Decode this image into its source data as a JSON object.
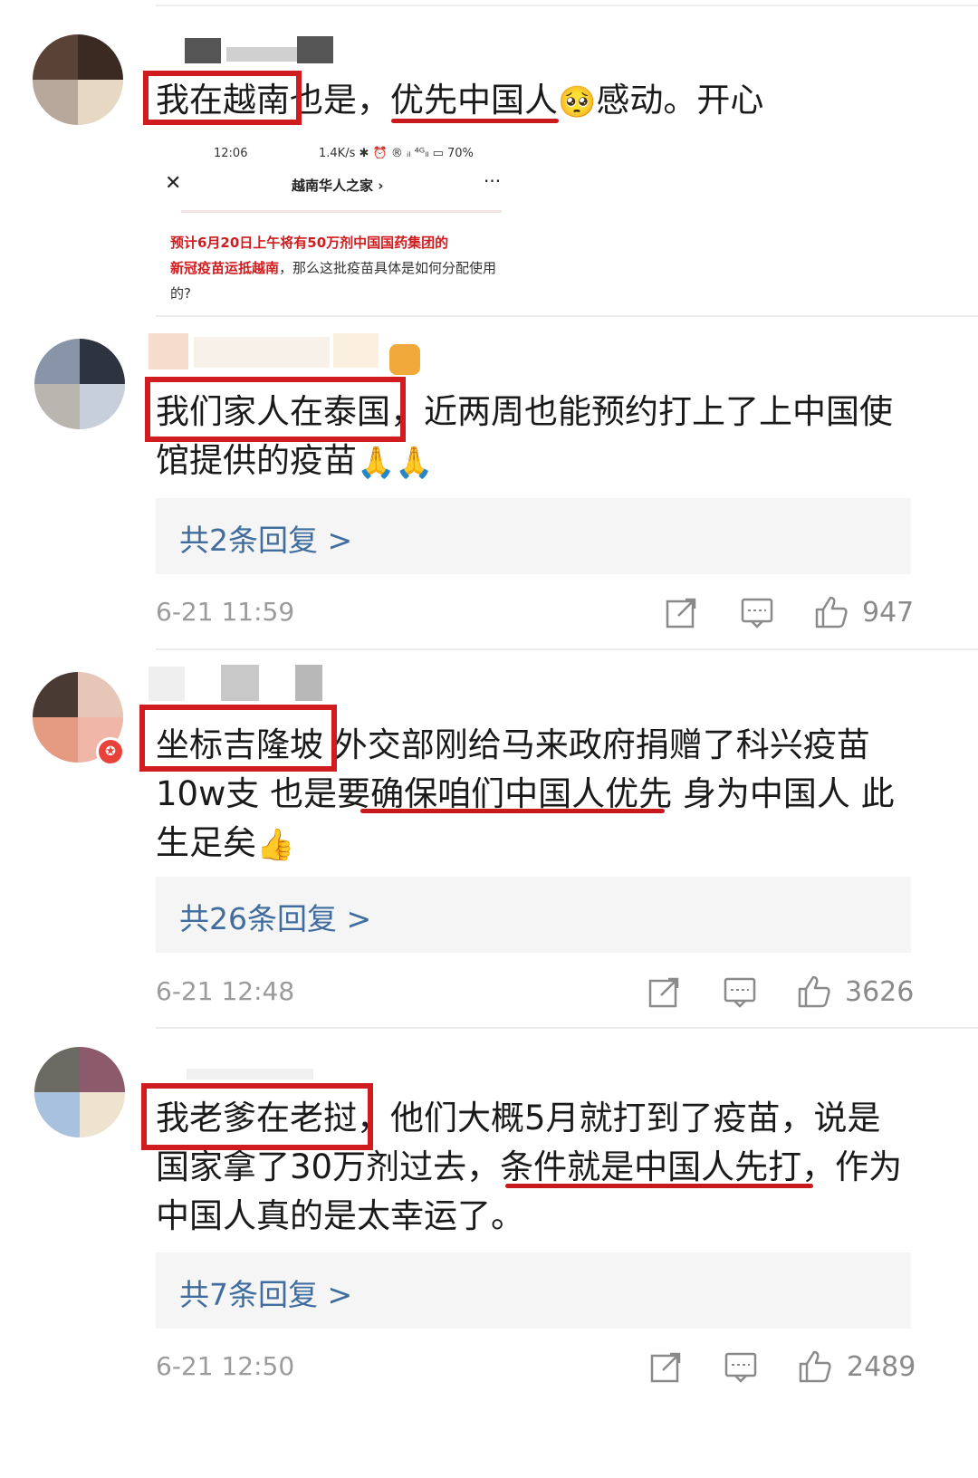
{
  "comments": [
    {
      "text_line1": "我在越南也是，优先中国人",
      "text_line1_after_emoji": "感动。开心",
      "emoji": "🥺",
      "embed": {
        "time": "12:06",
        "status": "1.4K/s ✱ ⏰ ® ᵢₗ ⁴ᴳₗₗ ▭ 70%",
        "close": "✕",
        "title": "越南华人之家 ›",
        "more": "···",
        "highlight_1": "预计6月20日上午将有50万剂中国国药集团的",
        "highlight_2": "新冠疫苗运抵越南",
        "rest": "，那么这批疫苗具体是如何分配使用的?"
      }
    },
    {
      "line1": "我们家人在泰国，近两周也能预约打上了上中国使",
      "line2": "馆提供的疫苗",
      "emoji": "🙏🙏",
      "replies": "共2条回复 >",
      "time": "6-21 11:59",
      "likes": "947"
    },
    {
      "line1": "坐标吉隆坡 外交部刚给马来政府捐赠了科兴疫苗",
      "line2": "10w支 也是要确保咱们中国人优先 身为中国人 此",
      "line3": "生足矣",
      "emoji": "👍",
      "replies": "共26条回复 >",
      "time": "6-21 12:48",
      "likes": "3626"
    },
    {
      "line1": "我老爹在老挝，他们大概5月就打到了疫苗，说是",
      "line2": "国家拿了30万剂过去，条件就是中国人先打，作为",
      "line3": "中国人真的是太幸运了。",
      "replies": "共7条回复 >",
      "time": "6-21 12:50",
      "likes": "2489"
    }
  ],
  "colors": {
    "annotation_red": "#d01c1f",
    "reply_link": "#3f6d9f",
    "meta_gray": "#9b9b9b"
  },
  "icons": [
    "share-icon",
    "comment-icon",
    "like-icon"
  ]
}
